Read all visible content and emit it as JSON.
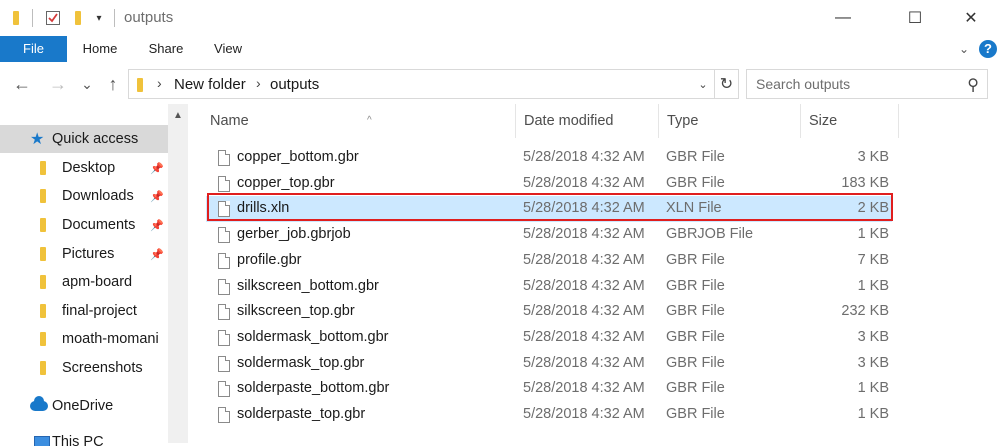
{
  "window": {
    "title": "outputs",
    "controls": {
      "minimize": "—",
      "maximize": "☐",
      "close": "✕"
    }
  },
  "ribbon": {
    "tabs": [
      "File",
      "Home",
      "Share",
      "View"
    ],
    "expand_icon": "chevron-down-icon",
    "help": "?"
  },
  "address": {
    "back": "←",
    "forward": "→",
    "recent": "⌄",
    "up": "↑",
    "crumbs": [
      "New folder",
      "outputs"
    ],
    "separator": "›",
    "refresh": "↻"
  },
  "search": {
    "placeholder": "Search outputs"
  },
  "nav": {
    "scroll_up": "▲",
    "items": [
      {
        "label": "Quick access",
        "icon": "star-icon",
        "pinned": false
      },
      {
        "label": "Desktop",
        "icon": "desktop-icon",
        "pinned": true
      },
      {
        "label": "Downloads",
        "icon": "downloads-icon",
        "pinned": true
      },
      {
        "label": "Documents",
        "icon": "documents-icon",
        "pinned": true
      },
      {
        "label": "Pictures",
        "icon": "pictures-icon",
        "pinned": true
      },
      {
        "label": "apm-board",
        "icon": "folder-icon",
        "pinned": false
      },
      {
        "label": "final-project",
        "icon": "folder-icon",
        "pinned": false
      },
      {
        "label": "moath-momani",
        "icon": "folder-icon",
        "pinned": false
      },
      {
        "label": "Screenshots",
        "icon": "folder-icon",
        "pinned": false
      },
      {
        "label": "OneDrive",
        "icon": "onedrive-icon",
        "pinned": false
      },
      {
        "label": "This PC",
        "icon": "this-pc-icon",
        "pinned": false
      }
    ]
  },
  "columns": {
    "name": "Name",
    "date": "Date modified",
    "type": "Type",
    "size": "Size",
    "sort_indicator": "^"
  },
  "files": [
    {
      "name": "copper_bottom.gbr",
      "date": "5/28/2018 4:32 AM",
      "type": "GBR File",
      "size": "3 KB"
    },
    {
      "name": "copper_top.gbr",
      "date": "5/28/2018 4:32 AM",
      "type": "GBR File",
      "size": "183 KB"
    },
    {
      "name": "drills.xln",
      "date": "5/28/2018 4:32 AM",
      "type": "XLN File",
      "size": "2 KB",
      "selected": true
    },
    {
      "name": "gerber_job.gbrjob",
      "date": "5/28/2018 4:32 AM",
      "type": "GBRJOB File",
      "size": "1 KB"
    },
    {
      "name": "profile.gbr",
      "date": "5/28/2018 4:32 AM",
      "type": "GBR File",
      "size": "7 KB"
    },
    {
      "name": "silkscreen_bottom.gbr",
      "date": "5/28/2018 4:32 AM",
      "type": "GBR File",
      "size": "1 KB"
    },
    {
      "name": "silkscreen_top.gbr",
      "date": "5/28/2018 4:32 AM",
      "type": "GBR File",
      "size": "232 KB"
    },
    {
      "name": "soldermask_bottom.gbr",
      "date": "5/28/2018 4:32 AM",
      "type": "GBR File",
      "size": "3 KB"
    },
    {
      "name": "soldermask_top.gbr",
      "date": "5/28/2018 4:32 AM",
      "type": "GBR File",
      "size": "3 KB"
    },
    {
      "name": "solderpaste_bottom.gbr",
      "date": "5/28/2018 4:32 AM",
      "type": "GBR File",
      "size": "1 KB"
    },
    {
      "name": "solderpaste_top.gbr",
      "date": "5/28/2018 4:32 AM",
      "type": "GBR File",
      "size": "1 KB"
    }
  ],
  "colors": {
    "accent": "#1979ca",
    "selection": "#cce8ff",
    "highlight_border": "#e01e1e",
    "quick_access_bg": "#d9d9d9"
  }
}
